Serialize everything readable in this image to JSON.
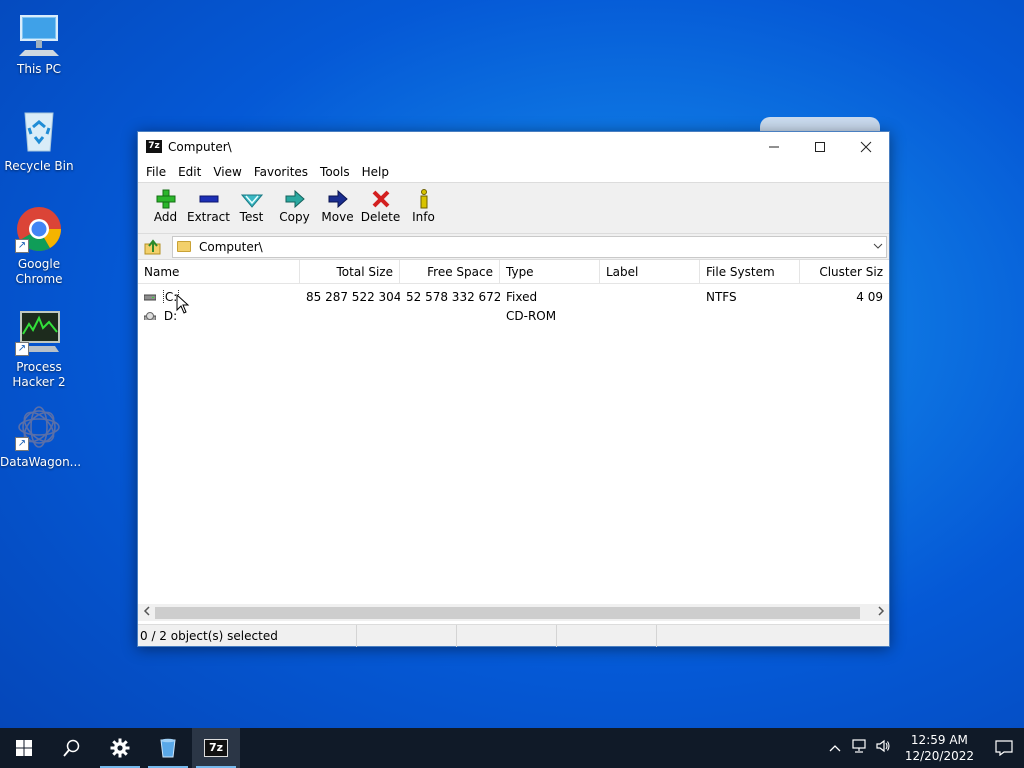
{
  "desktop": {
    "icons": [
      {
        "label": "This PC"
      },
      {
        "label": "Recycle Bin"
      },
      {
        "label": "Google Chrome"
      },
      {
        "label": "Process Hacker 2"
      },
      {
        "label": "DataWagon..."
      }
    ]
  },
  "window": {
    "app_icon_text": "7z",
    "title": "Computer\\",
    "controls": {
      "minimize": "—",
      "maximize": "☐",
      "close": "✕"
    }
  },
  "menu": [
    "File",
    "Edit",
    "View",
    "Favorites",
    "Tools",
    "Help"
  ],
  "toolbar": [
    {
      "label": "Add",
      "icon": "plus-icon",
      "color": "#2bb62b"
    },
    {
      "label": "Extract",
      "icon": "minus-icon",
      "color": "#1c2fb5"
    },
    {
      "label": "Test",
      "icon": "check-icon",
      "color": "#3bb8c4"
    },
    {
      "label": "Copy",
      "icon": "arrow-right-icon",
      "color": "#2aa8a0"
    },
    {
      "label": "Move",
      "icon": "arrow-right-icon",
      "color": "#1a2d8f"
    },
    {
      "label": "Delete",
      "icon": "x-icon",
      "color": "#d32020"
    },
    {
      "label": "Info",
      "icon": "info-icon",
      "color": "#d8c300"
    }
  ],
  "address": {
    "path": "Computer\\"
  },
  "list": {
    "columns": [
      "Name",
      "Total Size",
      "Free Space",
      "Type",
      "Label",
      "File System",
      "Cluster Siz"
    ],
    "rows": [
      {
        "name": "C:",
        "total": "85 287 522 304",
        "free": "52 578 332 672",
        "type": "Fixed",
        "label": "",
        "fs": "NTFS",
        "cluster": "4 09"
      },
      {
        "name": "D:",
        "total": "",
        "free": "",
        "type": "CD-ROM",
        "label": "",
        "fs": "",
        "cluster": ""
      }
    ]
  },
  "status": {
    "selected": "0 / 2 object(s) selected"
  },
  "taskbar": {
    "clock_time": "12:59 AM",
    "clock_date": "12/20/2022",
    "app_7z_label": "7z"
  }
}
